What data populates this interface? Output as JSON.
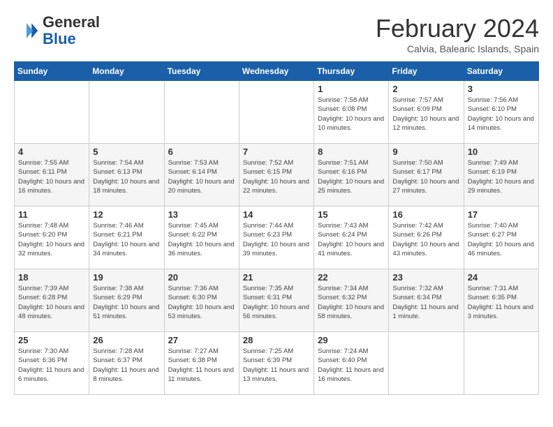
{
  "header": {
    "logo": {
      "general": "General",
      "blue": "Blue"
    },
    "title": "February 2024",
    "subtitle": "Calvia, Balearic Islands, Spain"
  },
  "weekdays": [
    "Sunday",
    "Monday",
    "Tuesday",
    "Wednesday",
    "Thursday",
    "Friday",
    "Saturday"
  ],
  "weeks": [
    [
      {
        "day": null
      },
      {
        "day": null
      },
      {
        "day": null
      },
      {
        "day": null
      },
      {
        "day": 1,
        "sunrise": "7:58 AM",
        "sunset": "6:08 PM",
        "daylight": "10 hours and 10 minutes."
      },
      {
        "day": 2,
        "sunrise": "7:57 AM",
        "sunset": "6:09 PM",
        "daylight": "10 hours and 12 minutes."
      },
      {
        "day": 3,
        "sunrise": "7:56 AM",
        "sunset": "6:10 PM",
        "daylight": "10 hours and 14 minutes."
      }
    ],
    [
      {
        "day": 4,
        "sunrise": "7:55 AM",
        "sunset": "6:11 PM",
        "daylight": "10 hours and 16 minutes."
      },
      {
        "day": 5,
        "sunrise": "7:54 AM",
        "sunset": "6:13 PM",
        "daylight": "10 hours and 18 minutes."
      },
      {
        "day": 6,
        "sunrise": "7:53 AM",
        "sunset": "6:14 PM",
        "daylight": "10 hours and 20 minutes."
      },
      {
        "day": 7,
        "sunrise": "7:52 AM",
        "sunset": "6:15 PM",
        "daylight": "10 hours and 22 minutes."
      },
      {
        "day": 8,
        "sunrise": "7:51 AM",
        "sunset": "6:16 PM",
        "daylight": "10 hours and 25 minutes."
      },
      {
        "day": 9,
        "sunrise": "7:50 AM",
        "sunset": "6:17 PM",
        "daylight": "10 hours and 27 minutes."
      },
      {
        "day": 10,
        "sunrise": "7:49 AM",
        "sunset": "6:19 PM",
        "daylight": "10 hours and 29 minutes."
      }
    ],
    [
      {
        "day": 11,
        "sunrise": "7:48 AM",
        "sunset": "6:20 PM",
        "daylight": "10 hours and 32 minutes."
      },
      {
        "day": 12,
        "sunrise": "7:46 AM",
        "sunset": "6:21 PM",
        "daylight": "10 hours and 34 minutes."
      },
      {
        "day": 13,
        "sunrise": "7:45 AM",
        "sunset": "6:22 PM",
        "daylight": "10 hours and 36 minutes."
      },
      {
        "day": 14,
        "sunrise": "7:44 AM",
        "sunset": "6:23 PM",
        "daylight": "10 hours and 39 minutes."
      },
      {
        "day": 15,
        "sunrise": "7:43 AM",
        "sunset": "6:24 PM",
        "daylight": "10 hours and 41 minutes."
      },
      {
        "day": 16,
        "sunrise": "7:42 AM",
        "sunset": "6:26 PM",
        "daylight": "10 hours and 43 minutes."
      },
      {
        "day": 17,
        "sunrise": "7:40 AM",
        "sunset": "6:27 PM",
        "daylight": "10 hours and 46 minutes."
      }
    ],
    [
      {
        "day": 18,
        "sunrise": "7:39 AM",
        "sunset": "6:28 PM",
        "daylight": "10 hours and 48 minutes."
      },
      {
        "day": 19,
        "sunrise": "7:38 AM",
        "sunset": "6:29 PM",
        "daylight": "10 hours and 51 minutes."
      },
      {
        "day": 20,
        "sunrise": "7:36 AM",
        "sunset": "6:30 PM",
        "daylight": "10 hours and 53 minutes."
      },
      {
        "day": 21,
        "sunrise": "7:35 AM",
        "sunset": "6:31 PM",
        "daylight": "10 hours and 56 minutes."
      },
      {
        "day": 22,
        "sunrise": "7:34 AM",
        "sunset": "6:32 PM",
        "daylight": "10 hours and 58 minutes."
      },
      {
        "day": 23,
        "sunrise": "7:32 AM",
        "sunset": "6:34 PM",
        "daylight": "11 hours and 1 minute."
      },
      {
        "day": 24,
        "sunrise": "7:31 AM",
        "sunset": "6:35 PM",
        "daylight": "11 hours and 3 minutes."
      }
    ],
    [
      {
        "day": 25,
        "sunrise": "7:30 AM",
        "sunset": "6:36 PM",
        "daylight": "11 hours and 6 minutes."
      },
      {
        "day": 26,
        "sunrise": "7:28 AM",
        "sunset": "6:37 PM",
        "daylight": "11 hours and 8 minutes."
      },
      {
        "day": 27,
        "sunrise": "7:27 AM",
        "sunset": "6:38 PM",
        "daylight": "11 hours and 11 minutes."
      },
      {
        "day": 28,
        "sunrise": "7:25 AM",
        "sunset": "6:39 PM",
        "daylight": "11 hours and 13 minutes."
      },
      {
        "day": 29,
        "sunrise": "7:24 AM",
        "sunset": "6:40 PM",
        "daylight": "11 hours and 16 minutes."
      },
      {
        "day": null
      },
      {
        "day": null
      }
    ]
  ]
}
